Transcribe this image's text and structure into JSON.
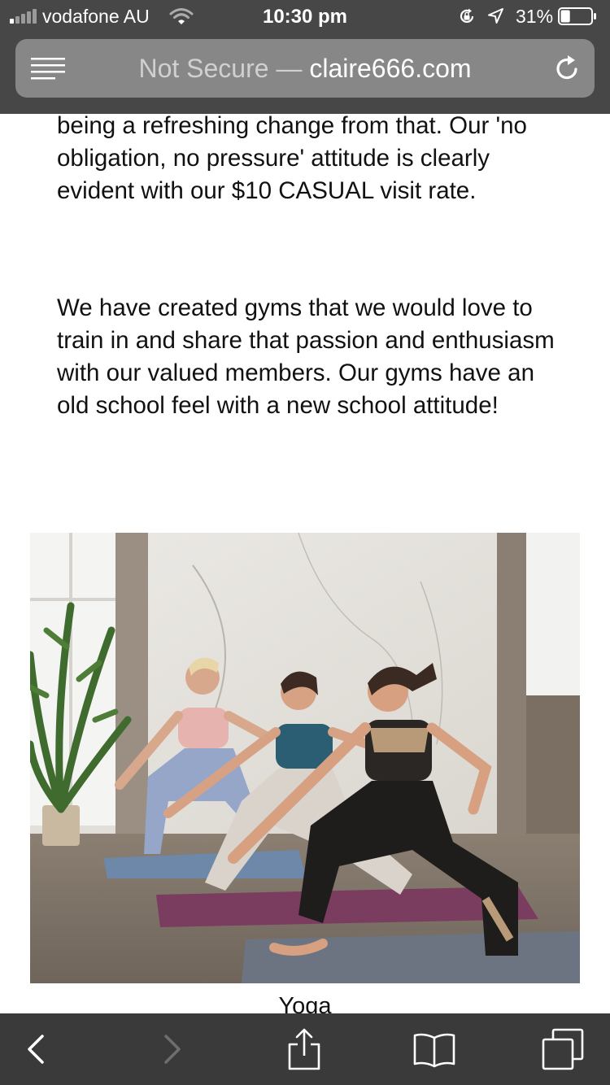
{
  "status": {
    "carrier": "vodafone AU",
    "time": "10:30 pm",
    "battery_percent": "31%",
    "battery_level": 0.31
  },
  "browser": {
    "not_secure": "Not Secure",
    "separator": " — ",
    "domain": "claire666.com"
  },
  "content": {
    "paragraph_1": "being a refreshing change from that. Our 'no obligation, no pressure' attitude is clearly evident with our $10 CASUAL visit rate.",
    "paragraph_2": "We have created gyms that we would love to train in and share that passion and enthusiasm with our valued members. Our gyms have an old school feel with a new school attitude!",
    "image_caption": "Yoga"
  },
  "toolbar": {
    "icons": [
      "back-icon",
      "forward-icon",
      "share-icon",
      "bookmarks-icon",
      "tabs-icon"
    ]
  },
  "colors": {
    "chrome": "#474747",
    "url_bar": "#878787",
    "toolbar": "#3a3a3a"
  }
}
